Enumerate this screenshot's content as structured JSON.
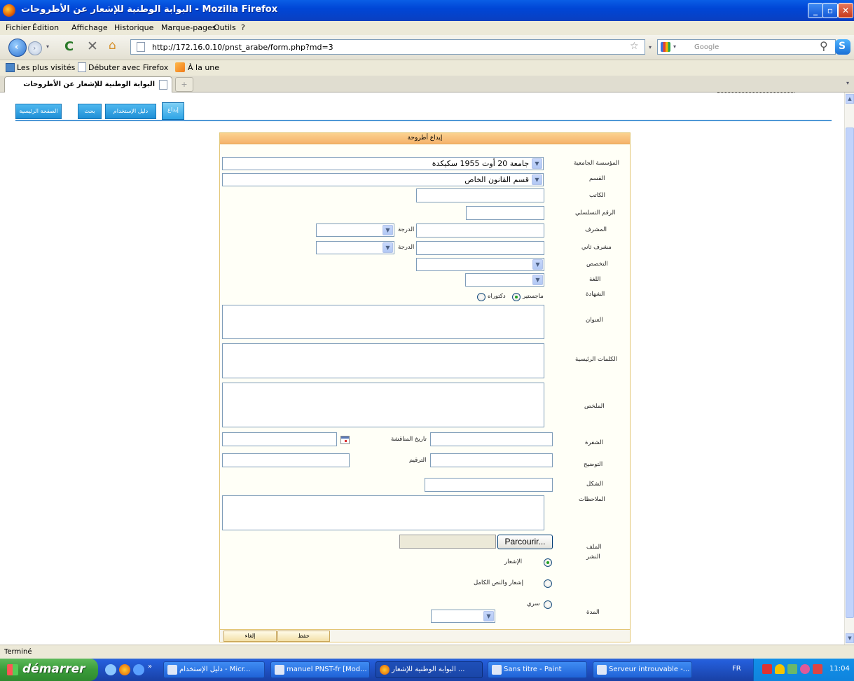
{
  "window": {
    "title": "البوابة الوطنية للإشعار عن الأطروحات - Mozilla Firefox"
  },
  "menu": [
    "Fichier",
    "Édition",
    "Affichage",
    "Historique",
    "Marque-pages",
    "Outils",
    "?"
  ],
  "toolbar": {
    "url": "http://172.16.0.10/pnst_arabe/form.php?md=3",
    "search_placeholder": "Google"
  },
  "bookmarks": [
    "Les plus visités",
    "Débuter avec Firefox",
    "À la une"
  ],
  "browser_tab": {
    "label": "البوابة الوطنية للإشعار عن الأطروحات",
    "new_tab_symbol": "+"
  },
  "site_nav": [
    "الصفحة الرئيسية",
    "بحث",
    "دليل الإستخدام",
    "إيداع"
  ],
  "form": {
    "header": "إيداع أطروحة",
    "labels": {
      "institution": "المؤسسة الجامعية",
      "department": "القسم",
      "author": "الكاتب",
      "serial": "الرقم التسلسلي",
      "supervisor": "المشرف",
      "degree_rank": "الدرجة",
      "cosupervisor": "مشرف ثاني",
      "specialty": "التخصص",
      "language": "اللغة",
      "diploma": "الشهادة",
      "title": "العنوان",
      "keywords": "الكلمات الرئيسية",
      "abstract": "الملخص",
      "code": "الشفرة",
      "defense_date": "تاريخ المناقشة",
      "clarification": "التوضيح",
      "numbering": "الترقيم",
      "shape": "الشكل",
      "notes": "الملاحظات",
      "file": "الملف",
      "publishing": "النشر",
      "duration": "المدة"
    },
    "institution_value": "جامعة 20 أوت 1955 سكيكدة",
    "department_value": "قسم القانون الخاص",
    "diploma_options": [
      {
        "label": "ماجستير",
        "checked": true
      },
      {
        "label": "دكتوراه",
        "checked": false
      }
    ],
    "publish_options": [
      {
        "label": "الإشعار",
        "checked": true
      },
      {
        "label": "إشعار والنص الكامل",
        "checked": false
      },
      {
        "label": "سري",
        "checked": false
      }
    ],
    "browse_button": "Parcourir...",
    "save_button": "حفظ",
    "cancel_button": "إلغاء"
  },
  "status": "Terminé",
  "taskbar": {
    "start": "démarrer",
    "tasks": [
      "دليل الإستخدام - Micr...",
      "manuel PNST-fr [Mod...",
      "البوابة الوطنية للإشعار ...",
      "Sans titre - Paint",
      "Serveur introuvable -..."
    ],
    "lang": "FR",
    "clock": "11:04"
  }
}
